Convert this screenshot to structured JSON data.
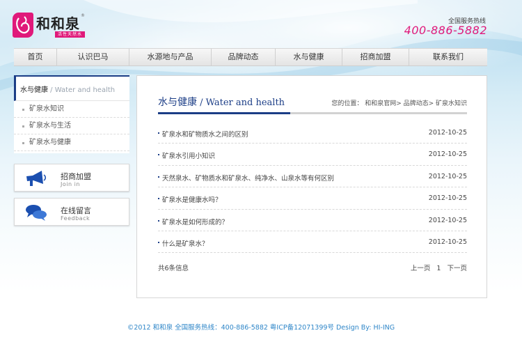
{
  "brand": {
    "title": "和和泉",
    "subtitle": "活性天然水",
    "registered": "®"
  },
  "hotline": {
    "label": "全国服务热线",
    "number": "400-886-5882"
  },
  "nav": [
    "首页",
    "认识巴马",
    "水源地与产品",
    "品牌动态",
    "水与健康",
    "招商加盟",
    "联系我们"
  ],
  "sidebar": {
    "title": "水与健康",
    "title_en": " / Water and health",
    "items": [
      "矿泉水知识",
      "矿泉水与生活",
      "矿泉水与健康"
    ]
  },
  "cards": [
    {
      "title": "招商加盟",
      "subtitle": "Join in",
      "icon": "megaphone-icon"
    },
    {
      "title": "在线留言",
      "subtitle": "Feedback",
      "icon": "chat-bubbles-icon"
    }
  ],
  "main": {
    "title": "水与健康",
    "title_en": " / Water and health",
    "breadcrumb": "您的位置： 和和泉官网> 品牌动态> 矿泉水知识",
    "articles": [
      {
        "title": "矿泉水和矿物质水之间的区别",
        "date": "2012-10-25"
      },
      {
        "title": "矿泉水引用小知识",
        "date": "2012-10-25"
      },
      {
        "title": "天然泉水、矿物质水和矿泉水、纯净水、山泉水等有何区别",
        "date": "2012-10-25"
      },
      {
        "title": "矿泉水是健康水吗？",
        "date": "2012-10-25"
      },
      {
        "title": "矿泉水是如何形成的？",
        "date": "2012-10-25"
      },
      {
        "title": "什么是矿泉水？",
        "date": "2012-10-25"
      }
    ],
    "count": "共6条信息",
    "pager": {
      "prev": "上一页",
      "current": "1",
      "next": "下一页"
    }
  },
  "footer": "©2012 和和泉 全国服务热线：400-886-5882 粤ICP备12071399号 Design By: HI-ING",
  "colors": {
    "accent_pink": "#e0197a",
    "navy": "#1b3d86",
    "footer_blue": "#2e86c8"
  }
}
